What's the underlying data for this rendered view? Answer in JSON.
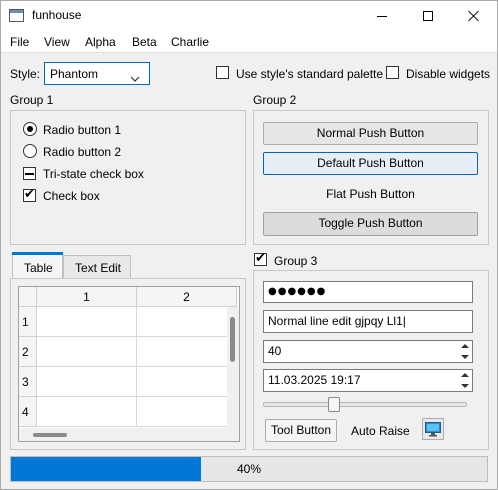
{
  "window": {
    "title": "funhouse"
  },
  "menu": [
    "File",
    "View",
    "Alpha",
    "Beta",
    "Charlie"
  ],
  "style_row": {
    "style_label": "Style:",
    "style_value": "Phantom",
    "standard_palette_label": "Use style's standard palette",
    "disable_widgets_label": "Disable widgets"
  },
  "group1": {
    "title": "Group 1",
    "radio1": "Radio button 1",
    "radio2": "Radio button 2",
    "tristate": "Tri-state check box",
    "checkbox": "Check box"
  },
  "group2": {
    "title": "Group 2",
    "normal": "Normal Push Button",
    "default": "Default Push Button",
    "flat": "Flat Push Button",
    "toggle": "Toggle Push Button"
  },
  "tabs": [
    "Table",
    "Text Edit"
  ],
  "table": {
    "columns": [
      "1",
      "2"
    ],
    "rows": [
      "1",
      "2",
      "3",
      "4"
    ]
  },
  "group3": {
    "title": "Group 3",
    "password": "●●●●●●",
    "line_edit": "Normal line edit gjpqy Ll1|",
    "spin_value": "40",
    "datetime": "11.03.2025 19:17",
    "slider_level": 0.34,
    "tool_button": "Tool Button",
    "auto_raise": "Auto Raise"
  },
  "progress": {
    "value": 0.4,
    "label": "40%"
  },
  "colors": {
    "accent": "#0078d7",
    "focus_border": "#0067c0"
  }
}
